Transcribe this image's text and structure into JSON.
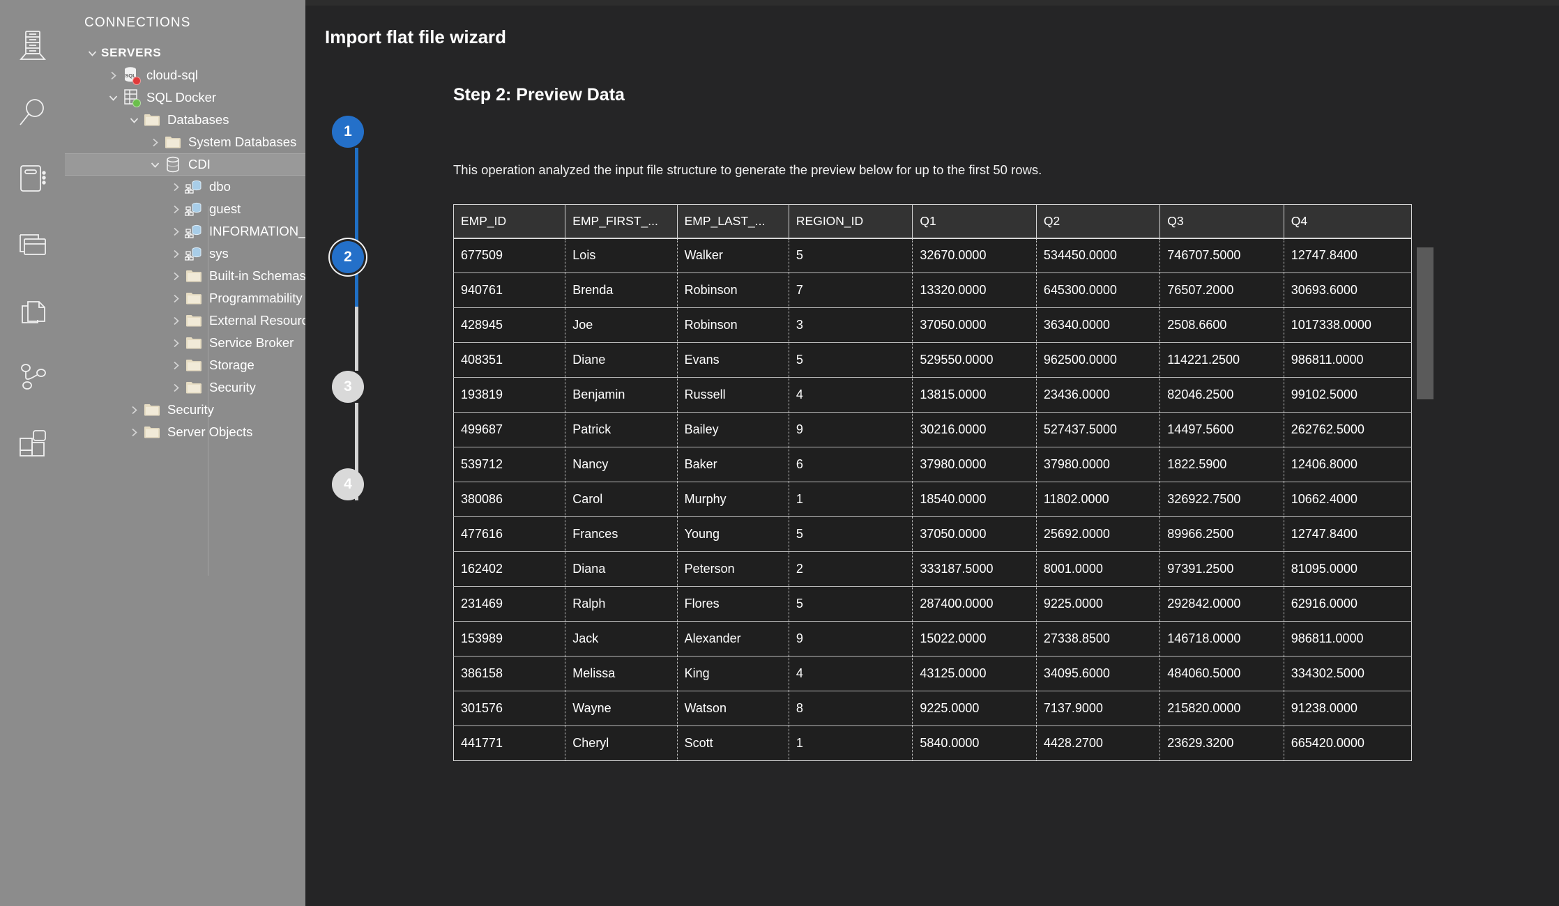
{
  "activity_bar": {
    "items": [
      {
        "name": "servers-icon",
        "label": "Servers"
      },
      {
        "name": "search-icon",
        "label": "Search"
      },
      {
        "name": "notebook-icon",
        "label": "Notebooks"
      },
      {
        "name": "query-history-icon",
        "label": "Query History"
      },
      {
        "name": "source-control-icon",
        "label": "Source Control"
      },
      {
        "name": "connections-graph-icon",
        "label": "Connections"
      },
      {
        "name": "extensions-icon",
        "label": "Extensions"
      }
    ]
  },
  "sidebar": {
    "title": "CONNECTIONS",
    "tree": [
      {
        "label": "SERVERS",
        "indent": 0,
        "twisty": "down",
        "icon": "none",
        "bold": true,
        "selected": false
      },
      {
        "label": "cloud-sql",
        "indent": 1,
        "twisty": "right",
        "icon": "server",
        "badge": "red",
        "selected": false
      },
      {
        "label": "SQL Docker",
        "indent": 1,
        "twisty": "down",
        "icon": "server2",
        "badge": "green",
        "selected": false
      },
      {
        "label": "Databases",
        "indent": 2,
        "twisty": "down",
        "icon": "folder",
        "selected": false
      },
      {
        "label": "System Databases",
        "indent": 3,
        "twisty": "right",
        "icon": "folder",
        "selected": false
      },
      {
        "label": "CDI",
        "indent": 3,
        "twisty": "down",
        "icon": "database",
        "selected": true
      },
      {
        "label": "dbo",
        "indent": 4,
        "twisty": "right",
        "icon": "schema",
        "selected": false
      },
      {
        "label": "guest",
        "indent": 4,
        "twisty": "right",
        "icon": "schema",
        "selected": false
      },
      {
        "label": "INFORMATION_SCHEMA",
        "indent": 4,
        "twisty": "right",
        "icon": "schema",
        "selected": false
      },
      {
        "label": "sys",
        "indent": 4,
        "twisty": "right",
        "icon": "schema",
        "selected": false
      },
      {
        "label": "Built-in Schemas",
        "indent": 4,
        "twisty": "right",
        "icon": "folder",
        "selected": false
      },
      {
        "label": "Programmability",
        "indent": 4,
        "twisty": "right",
        "icon": "folder",
        "selected": false
      },
      {
        "label": "External Resources",
        "indent": 4,
        "twisty": "right",
        "icon": "folder",
        "selected": false
      },
      {
        "label": "Service Broker",
        "indent": 4,
        "twisty": "right",
        "icon": "folder",
        "selected": false
      },
      {
        "label": "Storage",
        "indent": 4,
        "twisty": "right",
        "icon": "folder",
        "selected": false
      },
      {
        "label": "Security",
        "indent": 4,
        "twisty": "right",
        "icon": "folder",
        "selected": false
      },
      {
        "label": "Security",
        "indent": 2,
        "twisty": "right",
        "icon": "folder",
        "selected": false
      },
      {
        "label": "Server Objects",
        "indent": 2,
        "twisty": "right",
        "icon": "folder",
        "selected": false
      }
    ]
  },
  "wizard": {
    "title": "Import flat file wizard",
    "steps": [
      {
        "number": "1",
        "state": "active"
      },
      {
        "number": "2",
        "state": "current"
      },
      {
        "number": "3",
        "state": "pending"
      },
      {
        "number": "4",
        "state": "pending"
      }
    ],
    "step_heading": "Step 2: Preview Data",
    "description": "This operation analyzed the input file structure to generate the preview below for up to the first 50 rows."
  },
  "preview_table": {
    "columns": [
      "EMP_ID",
      "EMP_FIRST_...",
      "EMP_LAST_...",
      "REGION_ID",
      "Q1",
      "Q2",
      "Q3",
      "Q4"
    ],
    "rows": [
      [
        "677509",
        "Lois",
        "Walker",
        "5",
        "32670.0000",
        "534450.0000",
        "746707.5000",
        "12747.8400"
      ],
      [
        "940761",
        "Brenda",
        "Robinson",
        "7",
        "13320.0000",
        "645300.0000",
        "76507.2000",
        "30693.6000"
      ],
      [
        "428945",
        "Joe",
        "Robinson",
        "3",
        "37050.0000",
        "36340.0000",
        "2508.6600",
        "1017338.0000"
      ],
      [
        "408351",
        "Diane",
        "Evans",
        "5",
        "529550.0000",
        "962500.0000",
        "114221.2500",
        "986811.0000"
      ],
      [
        "193819",
        "Benjamin",
        "Russell",
        "4",
        "13815.0000",
        "23436.0000",
        "82046.2500",
        "99102.5000"
      ],
      [
        "499687",
        "Patrick",
        "Bailey",
        "9",
        "30216.0000",
        "527437.5000",
        "14497.5600",
        "262762.5000"
      ],
      [
        "539712",
        "Nancy",
        "Baker",
        "6",
        "37980.0000",
        "37980.0000",
        "1822.5900",
        "12406.8000"
      ],
      [
        "380086",
        "Carol",
        "Murphy",
        "1",
        "18540.0000",
        "11802.0000",
        "326922.7500",
        "10662.4000"
      ],
      [
        "477616",
        "Frances",
        "Young",
        "5",
        "37050.0000",
        "25692.0000",
        "89966.2500",
        "12747.8400"
      ],
      [
        "162402",
        "Diana",
        "Peterson",
        "2",
        "333187.5000",
        "8001.0000",
        "97391.2500",
        "81095.0000"
      ],
      [
        "231469",
        "Ralph",
        "Flores",
        "5",
        "287400.0000",
        "9225.0000",
        "292842.0000",
        "62916.0000"
      ],
      [
        "153989",
        "Jack",
        "Alexander",
        "9",
        "15022.0000",
        "27338.8500",
        "146718.0000",
        "986811.0000"
      ],
      [
        "386158",
        "Melissa",
        "King",
        "4",
        "43125.0000",
        "34095.6000",
        "484060.5000",
        "334302.5000"
      ],
      [
        "301576",
        "Wayne",
        "Watson",
        "8",
        "9225.0000",
        "7137.9000",
        "215820.0000",
        "91238.0000"
      ],
      [
        "441771",
        "Cheryl",
        "Scott",
        "1",
        "5840.0000",
        "4428.2700",
        "23629.3200",
        "665420.0000"
      ]
    ]
  },
  "colors": {
    "accent_blue": "#2470c9",
    "pending_gray": "#d9d9d9",
    "sidebar_bg": "#8c8c8c",
    "editor_bg": "#252526",
    "table_bg": "#1f1f1f",
    "status_red": "#e13a3a",
    "status_green": "#6abf4b"
  }
}
